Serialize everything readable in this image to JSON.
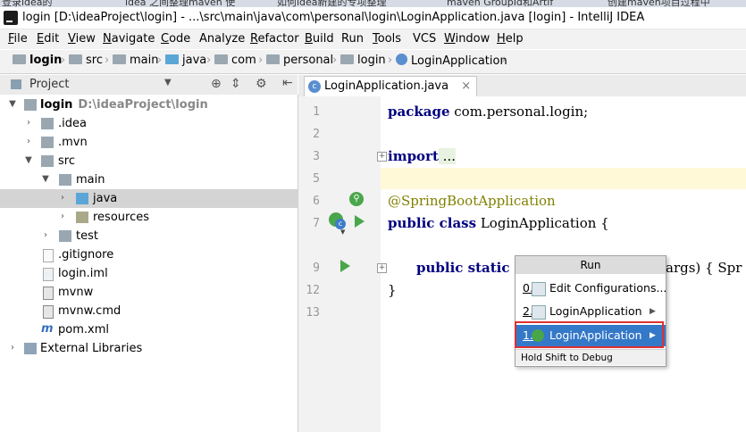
{
  "browser_tabs": [
    "登录idea的",
    "idea 之间整理maven 使",
    "如何idea新建的专项整理",
    "maven GroupId和Artif",
    "创建maven项目过程中"
  ],
  "window": {
    "title": "login [D:\\ideaProject\\login] - ...\\src\\main\\java\\com\\personal\\login\\LoginApplication.java [login] - IntelliJ IDEA"
  },
  "menu": [
    {
      "label": "File",
      "u": "F",
      "rest": "ile"
    },
    {
      "label": "Edit",
      "u": "E",
      "rest": "dit"
    },
    {
      "label": "View",
      "u": "V",
      "rest": "iew"
    },
    {
      "label": "Navigate",
      "u": "N",
      "rest": "avigate"
    },
    {
      "label": "Code",
      "u": "C",
      "rest": "ode"
    },
    {
      "label": "Analyze",
      "u": "",
      "rest": "Analyze"
    },
    {
      "label": "Refactor",
      "u": "R",
      "rest": "efactor"
    },
    {
      "label": "Build",
      "u": "B",
      "rest": "uild"
    },
    {
      "label": "Run",
      "u": "",
      "rest": "Run"
    },
    {
      "label": "Tools",
      "u": "T",
      "rest": "ools"
    },
    {
      "label": "VCS",
      "u": "",
      "rest": "VCS"
    },
    {
      "label": "Window",
      "u": "W",
      "rest": "indow"
    },
    {
      "label": "Help",
      "u": "H",
      "rest": "elp"
    }
  ],
  "breadcrumbs": [
    "login",
    "src",
    "main",
    "java",
    "com",
    "personal",
    "login",
    "LoginApplication"
  ],
  "project_panel": {
    "title": "Project",
    "tree": [
      {
        "label": "login",
        "path": "D:\\ideaProject\\login",
        "bold": true
      },
      {
        "label": ".idea"
      },
      {
        "label": ".mvn"
      },
      {
        "label": "src"
      },
      {
        "label": "main"
      },
      {
        "label": "java"
      },
      {
        "label": "resources"
      },
      {
        "label": "test"
      },
      {
        "label": ".gitignore"
      },
      {
        "label": "login.iml"
      },
      {
        "label": "mvnw"
      },
      {
        "label": "mvnw.cmd"
      },
      {
        "label": "pom.xml"
      },
      {
        "label": "External Libraries"
      }
    ]
  },
  "editor": {
    "tab_label": "LoginApplication.java",
    "line_numbers": [
      "1",
      "2",
      "3",
      "5",
      "6",
      "7",
      "9",
      "12",
      "13"
    ],
    "code": {
      "l1_kw": "package",
      "l1_rest": " com.personal.login;",
      "l3_kw": "import",
      "l3_rest": " ...",
      "l6_ann": "@SpringBootApplication",
      "l7_kw": "public class",
      "l7_rest": " LoginApplication {",
      "l9_kw": "public static",
      "l9_tail": "args) { Spr",
      "l12": "}"
    }
  },
  "run_popup": {
    "title": "Run",
    "items": [
      {
        "num": "0.",
        "label": "Edit Configurations...",
        "submenu": false
      },
      {
        "num": "2.",
        "label": "LoginApplication",
        "submenu": true
      },
      {
        "num": "1.",
        "label": "LoginApplication",
        "submenu": true,
        "selected": true
      }
    ],
    "footer": "Hold Shift to Debug"
  },
  "colors": {
    "selection": "#3478c8",
    "highlight_border": "#e03030",
    "keyword": "#000080",
    "annotation": "#808000"
  }
}
